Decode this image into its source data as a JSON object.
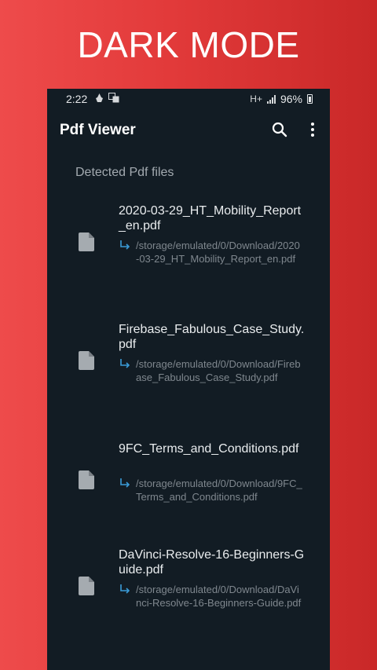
{
  "promo": {
    "title": "DARK MODE"
  },
  "status_bar": {
    "time": "2:22",
    "network": "H+",
    "battery": "96%"
  },
  "app_bar": {
    "title": "Pdf Viewer",
    "search_icon": "search-icon",
    "menu_icon": "more-vertical-icon"
  },
  "list": {
    "header": "Detected Pdf files",
    "files": [
      {
        "name": "2020-03-29_HT_Mobility_Report_en.pdf",
        "path": "/storage/emulated/0/Download/2020-03-29_HT_Mobility_Report_en.pdf"
      },
      {
        "name": "Firebase_Fabulous_Case_Study.pdf",
        "path": "/storage/emulated/0/Download/Firebase_Fabulous_Case_Study.pdf"
      },
      {
        "name": "9FC_Terms_and_Conditions.pdf",
        "path": "/storage/emulated/0/Download/9FC_Terms_and_Conditions.pdf"
      },
      {
        "name": "DaVinci-Resolve-16-Beginners-Guide.pdf",
        "path": "/storage/emulated/0/Download/DaVinci-Resolve-16-Beginners-Guide.pdf"
      }
    ]
  },
  "colors": {
    "accent_arrow": "#3a9bd8",
    "background": "#121c24",
    "promo_background": "#e23a3a"
  }
}
